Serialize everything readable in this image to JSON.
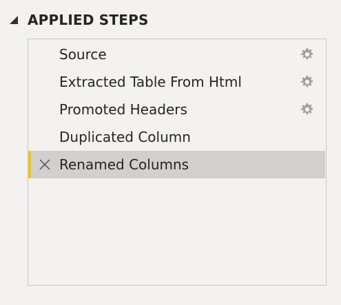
{
  "section": {
    "title": "APPLIED STEPS",
    "collapse_icon": "collapse-triangle-icon"
  },
  "steps": [
    {
      "label": "Source",
      "has_settings": true,
      "selected": false
    },
    {
      "label": "Extracted Table From Html",
      "has_settings": true,
      "selected": false
    },
    {
      "label": "Promoted Headers",
      "has_settings": true,
      "selected": false
    },
    {
      "label": "Duplicated Column",
      "has_settings": false,
      "selected": false
    },
    {
      "label": "Renamed Columns",
      "has_settings": false,
      "selected": true
    }
  ],
  "colors": {
    "selected_background": "#d2d0ce",
    "selected_accent": "#f2c811",
    "gear": "#a19f9d"
  },
  "icons": {
    "settings": "gear-icon",
    "delete": "close-x-icon"
  }
}
